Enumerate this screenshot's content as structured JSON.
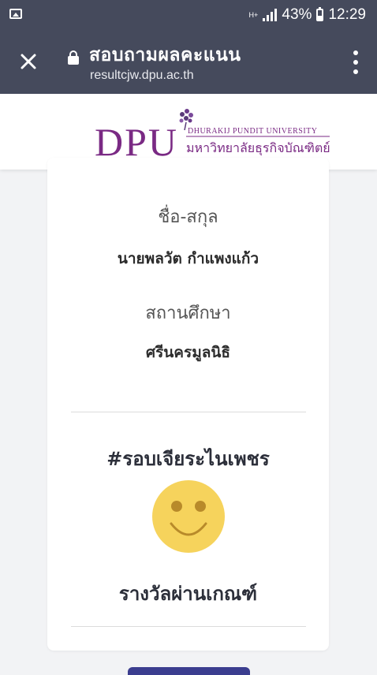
{
  "status_bar": {
    "network_type": "H+",
    "battery_percent": "43%",
    "time": "12:29"
  },
  "browser": {
    "title": "สอบถามผลคะแนน",
    "url": "resultcjw.dpu.ac.th"
  },
  "logo": {
    "abbr": "DPU",
    "english_name": "DHURAKIJ PUNDIT UNIVERSITY",
    "thai_name": "มหาวิทยาลัยธุรกิจบัณฑิตย์"
  },
  "result": {
    "name_label": "ชื่อ-สกุล",
    "name_value": "นายพลวัต กำแพงแก้ว",
    "school_label": "สถานศึกษา",
    "school_value": "ศรีนครมูลนิธิ",
    "round_title": "#รอบเจียระไนเพชร",
    "award_text": "รางวัลผ่านเกณฑ์"
  },
  "colors": {
    "toolbar": "#454a5c",
    "brand_purple": "#7a2a84",
    "smiley_face": "#f6d35c",
    "smiley_features": "#b88a2a"
  },
  "icons": [
    "image-icon",
    "signal-icon",
    "battery-icon",
    "close-icon",
    "lock-icon",
    "more-vert-icon",
    "smiley-icon"
  ]
}
